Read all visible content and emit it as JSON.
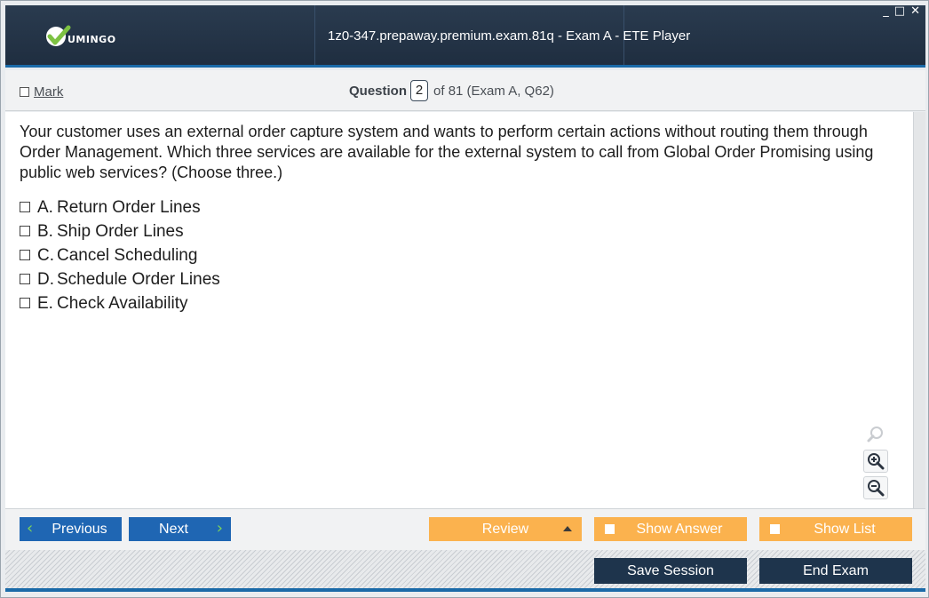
{
  "app": {
    "logo_text": "UMINGO",
    "title": "1z0-347.prepaway.premium.exam.81q - Exam A - ETE Player",
    "window_controls": {
      "minimize": "_",
      "maximize": "□",
      "close": "✕"
    }
  },
  "header": {
    "mark_label": "Mark",
    "question_label": "Question",
    "current_question": "2",
    "of_text": "of 81 (Exam A, Q62)"
  },
  "question": {
    "text": "Your customer uses an external order capture system and wants to perform certain actions without routing them through Order Management. Which three services are available for the external system to call from Global Order Promising using public web services? (Choose three.)",
    "options": [
      {
        "letter": "A.",
        "text": "Return Order Lines"
      },
      {
        "letter": "B.",
        "text": "Ship Order Lines"
      },
      {
        "letter": "C.",
        "text": "Cancel Scheduling"
      },
      {
        "letter": "D.",
        "text": "Schedule Order Lines"
      },
      {
        "letter": "E.",
        "text": "Check Availability"
      }
    ]
  },
  "nav": {
    "previous": "Previous",
    "next": "Next",
    "review": "Review",
    "show_answer": "Show Answer",
    "show_list": "Show List"
  },
  "footer": {
    "save_session": "Save Session",
    "end_exam": "End Exam"
  },
  "colors": {
    "title_bar": "#1f2e40",
    "accent_blue": "#1f66b3",
    "orange": "#fbb24e",
    "dark_button": "#1e344c",
    "logo_green": "#7dc242"
  }
}
